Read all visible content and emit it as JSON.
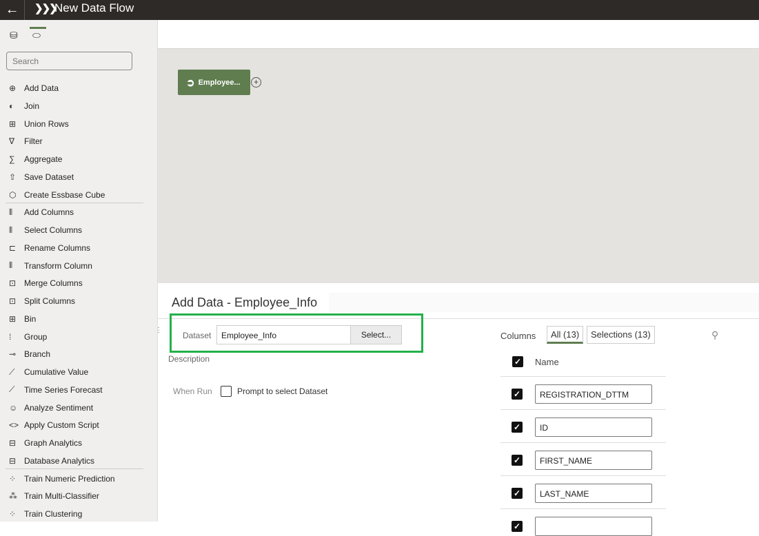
{
  "header": {
    "title": "New Data Flow",
    "back_icon": "arrow-left",
    "logo_icon": "chevrons"
  },
  "sidebar": {
    "search_placeholder": "Search",
    "items": [
      {
        "label": "Add Data",
        "icon": "⊕"
      },
      {
        "label": "Join",
        "icon": "◐"
      },
      {
        "label": "Union Rows",
        "icon": "⊞"
      },
      {
        "label": "Filter",
        "icon": "∇"
      },
      {
        "label": "Aggregate",
        "icon": "∑"
      },
      {
        "label": "Save Dataset",
        "icon": "⇧"
      },
      {
        "label": "Create Essbase Cube",
        "icon": "⬡"
      },
      {
        "label": "Add Columns",
        "icon": "⫴"
      },
      {
        "label": "Select Columns",
        "icon": "⫴"
      },
      {
        "label": "Rename Columns",
        "icon": "⊏"
      },
      {
        "label": "Transform Column",
        "icon": "⫴"
      },
      {
        "label": "Merge Columns",
        "icon": "⊡"
      },
      {
        "label": "Split Columns",
        "icon": "⊡"
      },
      {
        "label": "Bin",
        "icon": "⊞"
      },
      {
        "label": "Group",
        "icon": "⁞"
      },
      {
        "label": "Branch",
        "icon": "⊸"
      },
      {
        "label": "Cumulative Value",
        "icon": "⟋"
      },
      {
        "label": "Time Series Forecast",
        "icon": "⟋"
      },
      {
        "label": "Analyze Sentiment",
        "icon": "☺"
      },
      {
        "label": "Apply Custom Script",
        "icon": "<>"
      },
      {
        "label": "Graph Analytics",
        "icon": "⊟"
      },
      {
        "label": "Database Analytics",
        "icon": "⊟"
      },
      {
        "label": "Train Numeric Prediction",
        "icon": "⁘"
      },
      {
        "label": "Train Multi-Classifier",
        "icon": "⁂"
      },
      {
        "label": "Train Clustering",
        "icon": "⁘"
      }
    ]
  },
  "canvas": {
    "node_label": "Employee..."
  },
  "panel": {
    "title": "Add Data - Employee_Info",
    "dataset_label": "Dataset",
    "dataset_value": "Employee_Info",
    "select_button": "Select...",
    "description_label": "Description",
    "when_run_label": "When Run",
    "prompt_label": "Prompt to select Dataset",
    "prompt_checked": false,
    "columns_label": "Columns",
    "tab_all": "All (13)",
    "tab_selections": "Selections (13)",
    "name_header": "Name",
    "columns": [
      "REGISTRATION_DTTM",
      "ID",
      "FIRST_NAME",
      "LAST_NAME",
      ""
    ]
  }
}
